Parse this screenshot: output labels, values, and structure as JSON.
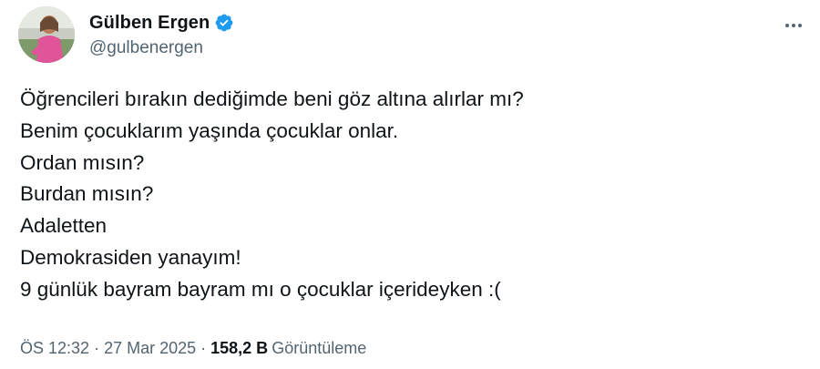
{
  "author": {
    "display_name": "Gülben Ergen",
    "handle": "@gulbenergen",
    "verified": true,
    "verified_color": "#1d9bf0"
  },
  "tweet": {
    "lines": [
      "Öğrencileri bırakın dediğimde beni göz altına alırlar mı?",
      "Benim çocuklarım yaşında çocuklar onlar.",
      "Ordan mısın?",
      "Burdan mısın?",
      "Adaletten",
      "Demokrasiden yanayım!",
      "9 günlük bayram bayram mı o çocuklar içerideyken :("
    ]
  },
  "meta": {
    "time": "ÖS 12:32",
    "separator": "·",
    "date": "27 Mar 2025",
    "views_count": "158,2 B",
    "views_label": "Görüntüleme"
  },
  "icons": {
    "verified": "verified-badge-icon",
    "more": "more-options-icon"
  }
}
